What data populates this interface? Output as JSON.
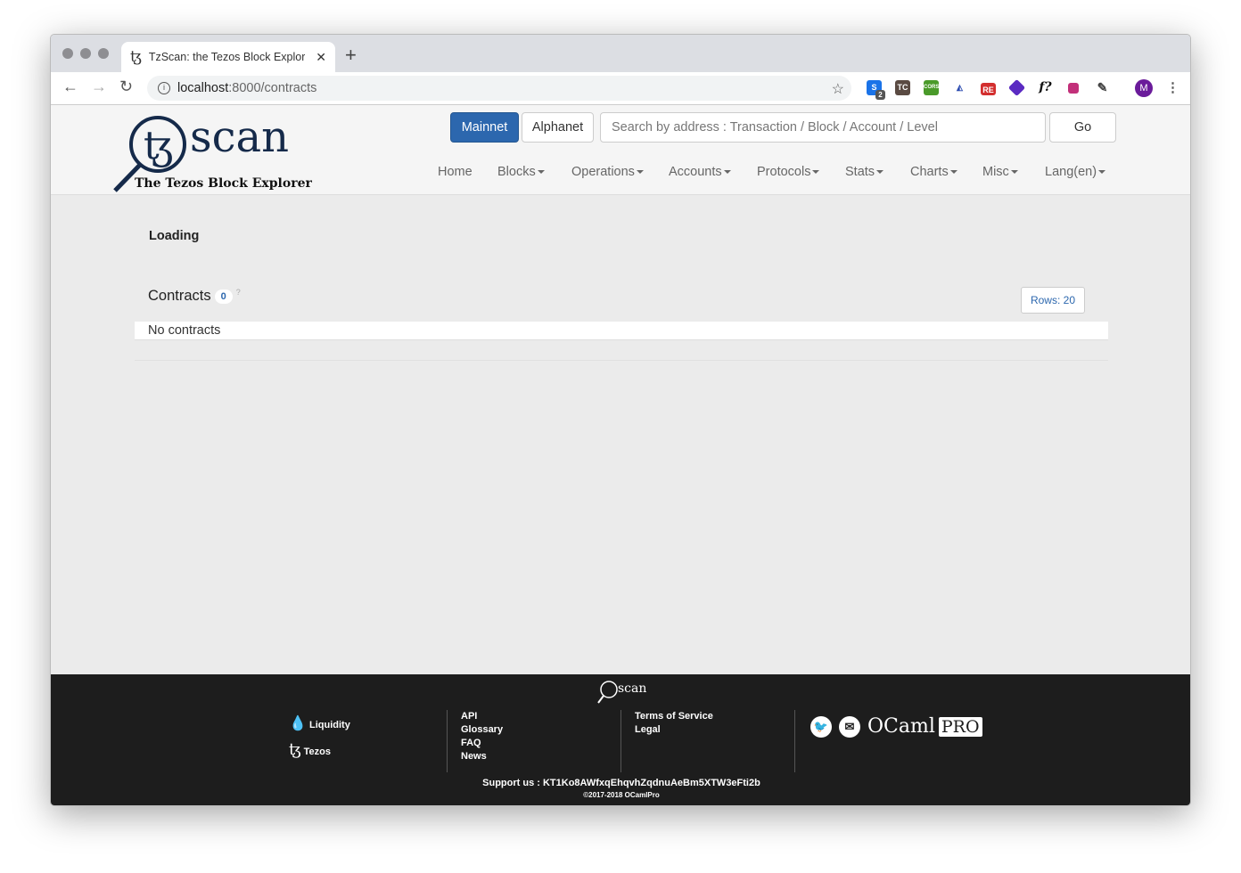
{
  "browser": {
    "tab_title": "TzScan: the Tezos Block Explorer",
    "url_host": "localhost",
    "url_rest": ":8000/contracts",
    "avatar_letter": "M",
    "extension_badge": "2"
  },
  "header": {
    "logo_text": "scan",
    "logo_tagline": "The Tezos Block Explorer",
    "networks": [
      "Mainnet",
      "Alphanet"
    ],
    "search_placeholder": "Search by address : Transaction / Block / Account / Level",
    "go_label": "Go",
    "menu": [
      {
        "label": "Home",
        "dropdown": false
      },
      {
        "label": "Blocks",
        "dropdown": true
      },
      {
        "label": "Operations",
        "dropdown": true
      },
      {
        "label": "Accounts",
        "dropdown": true
      },
      {
        "label": "Protocols",
        "dropdown": true
      },
      {
        "label": "Stats",
        "dropdown": true
      },
      {
        "label": "Charts",
        "dropdown": true
      },
      {
        "label": "Misc",
        "dropdown": true
      },
      {
        "label": "Lang(en)",
        "dropdown": true
      }
    ]
  },
  "main": {
    "loading": "Loading",
    "title": "Contracts",
    "count": "0",
    "help": "?",
    "rows_label": "Rows: 20",
    "empty": "No contracts"
  },
  "footer": {
    "logo_text": "scan",
    "col1": [
      "Liquidity",
      "Tezos"
    ],
    "col2": [
      "API",
      "Glossary",
      "FAQ",
      "News"
    ],
    "col3": [
      "Terms of Service",
      "Legal"
    ],
    "brand": "OCaml",
    "brand_box": "PRO",
    "support": "Support us : KT1Ko8AWfxqEhqvhZqdnuAeBm5XTW3eFti2b",
    "copyright": "©2017-2018 OCamlPro"
  }
}
